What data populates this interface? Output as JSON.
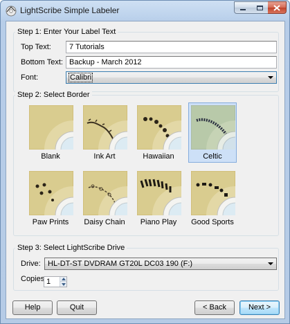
{
  "window": {
    "title": "LightScribe Simple Labeler"
  },
  "step1": {
    "heading": "Step 1: Enter Your Label Text",
    "top_text_label": "Top Text:",
    "top_text_value": "7 Tutorials",
    "bottom_text_label": "Bottom Text:",
    "bottom_text_value": "Backup - March 2012",
    "font_label": "Font:",
    "font_value": "Calibri"
  },
  "step2": {
    "heading": "Step 2: Select Border",
    "borders": [
      {
        "label": "Blank",
        "selected": false,
        "icon": "blank-border-thumbnail"
      },
      {
        "label": "Ink Art",
        "selected": false,
        "icon": "ink-art-border-thumbnail"
      },
      {
        "label": "Hawaiian",
        "selected": false,
        "icon": "hawaiian-border-thumbnail"
      },
      {
        "label": "Celtic",
        "selected": true,
        "icon": "celtic-border-thumbnail"
      },
      {
        "label": "Paw Prints",
        "selected": false,
        "icon": "paw-prints-border-thumbnail"
      },
      {
        "label": "Daisy Chain",
        "selected": false,
        "icon": "daisy-chain-border-thumbnail"
      },
      {
        "label": "Piano Play",
        "selected": false,
        "icon": "piano-play-border-thumbnail"
      },
      {
        "label": "Good Sports",
        "selected": false,
        "icon": "good-sports-border-thumbnail"
      }
    ]
  },
  "step3": {
    "heading": "Step 3: Select LightScribe Drive",
    "drive_label": "Drive:",
    "drive_value": "HL-DT-ST DVDRAM GT20L DC03 190 (F:)",
    "copies_label": "Copies:",
    "copies_value": "1"
  },
  "buttons": {
    "help": "Help",
    "quit": "Quit",
    "back": "< Back",
    "next": "Next >"
  },
  "colors": {
    "selection_fill": "#cde0f7",
    "selection_border": "#84acdd",
    "disc_gold": "#d8c98c"
  }
}
